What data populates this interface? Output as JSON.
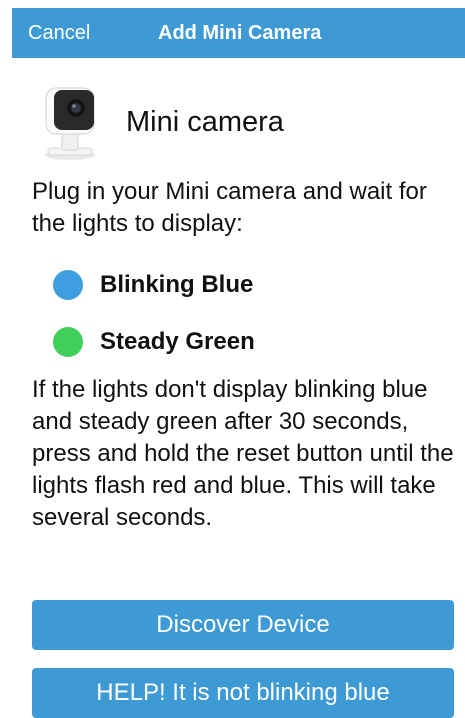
{
  "header": {
    "cancel_label": "Cancel",
    "title": "Add Mini Camera"
  },
  "device": {
    "icon": "mini-camera-image",
    "name": "Mini camera"
  },
  "instructions": "Plug in your Mini camera and wait for the lights to display:",
  "lights": [
    {
      "label": "Blinking Blue",
      "color": "#3f9ee0"
    },
    {
      "label": "Steady Green",
      "color": "#3fcf5a"
    }
  ],
  "help_text": "If the lights don't display blinking blue and steady green after 30 seconds, press and hold the reset button until the lights flash red and blue. This will take several seconds.",
  "buttons": {
    "discover_label": "Discover Device",
    "help_label": "HELP! It is not blinking blue"
  },
  "colors": {
    "accent": "#3d9ad4"
  }
}
